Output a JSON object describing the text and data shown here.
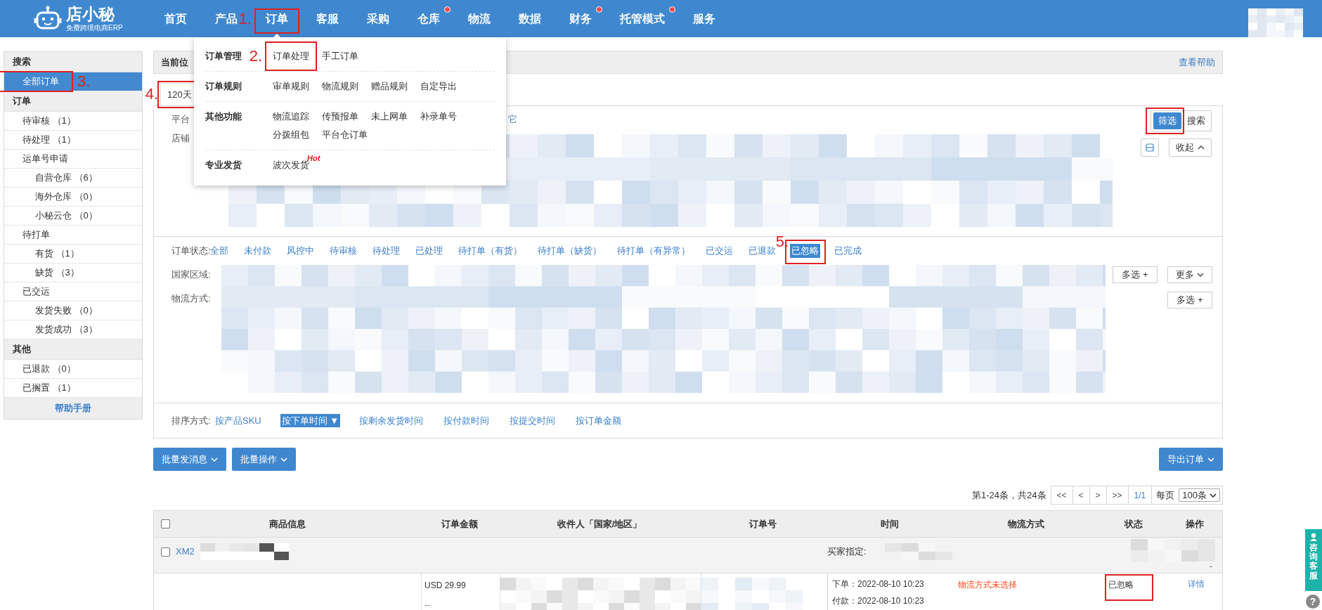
{
  "nav": {
    "logo_title": "店小秘",
    "logo_subtitle": "免费跨境电商ERP",
    "items": [
      {
        "label": "首页",
        "selected": false,
        "badge": false
      },
      {
        "label": "产品",
        "selected": false,
        "badge": false
      },
      {
        "label": "订单",
        "selected": true,
        "badge": false,
        "step": "1."
      },
      {
        "label": "客服",
        "selected": false,
        "badge": false
      },
      {
        "label": "采购",
        "selected": false,
        "badge": false
      },
      {
        "label": "仓库",
        "selected": false,
        "badge": true
      },
      {
        "label": "物流",
        "selected": false,
        "badge": false
      },
      {
        "label": "数据",
        "selected": false,
        "badge": false
      },
      {
        "label": "财务",
        "selected": false,
        "badge": true
      },
      {
        "label": "托管模式",
        "selected": false,
        "badge": true
      },
      {
        "label": "服务",
        "selected": false,
        "badge": false
      }
    ]
  },
  "dropdown": {
    "groups": [
      {
        "title": "订单管理",
        "items": [
          {
            "label": "订单处理",
            "step": "2."
          },
          {
            "label": "手工订单"
          }
        ]
      },
      {
        "title": "订单规则",
        "items": [
          {
            "label": "审单规则"
          },
          {
            "label": "物流规则"
          },
          {
            "label": "赠品规则"
          },
          {
            "label": "自定导出"
          }
        ]
      },
      {
        "title": "其他功能",
        "items": [
          {
            "label": "物流追踪"
          },
          {
            "label": "传预报单"
          },
          {
            "label": "未上网单"
          },
          {
            "label": "补录单号"
          },
          {
            "label": "分拨组包"
          },
          {
            "label": "平台仓订单"
          }
        ]
      },
      {
        "title": "专业发货",
        "items": [
          {
            "label": "波次发货",
            "tag": "Hot"
          }
        ]
      }
    ]
  },
  "sidebar": {
    "sections": [
      {
        "title": "搜索",
        "items": [
          {
            "label": "全部订单",
            "selected": true,
            "step": "3."
          }
        ]
      },
      {
        "title": "订单",
        "items": [
          {
            "label": "待审核 （1）",
            "selected": false
          },
          {
            "label": "待处理 （1）",
            "selected": false
          },
          {
            "label": "运单号申请",
            "selected": false,
            "children": [
              {
                "label": "自营仓库 （6）",
                "selected": false
              },
              {
                "label": "海外仓库 （0）",
                "selected": false
              },
              {
                "label": "小秘云仓 （0）",
                "selected": false
              }
            ]
          },
          {
            "label": "待打单",
            "selected": false,
            "children": [
              {
                "label": "有货 （1）",
                "selected": false
              },
              {
                "label": "缺货 （3）",
                "selected": false
              }
            ]
          },
          {
            "label": "已交运",
            "selected": false,
            "children": [
              {
                "label": "发货失败 （0）",
                "selected": false
              },
              {
                "label": "发货成功 （3）",
                "selected": false
              }
            ]
          }
        ]
      },
      {
        "title": "其他",
        "items": [
          {
            "label": "已退款 （0）",
            "selected": false
          },
          {
            "label": "已搁置 （1）",
            "selected": false
          }
        ]
      }
    ],
    "help": "帮助手册"
  },
  "breadcrumb": {
    "label": "当前位",
    "help": "查看帮助"
  },
  "period": {
    "label": "120天",
    "step": "4."
  },
  "filters": {
    "platform_label": "平台",
    "platform_tail": "它",
    "shop_label": "店铺",
    "filter_button": {
      "label": "筛选",
      "selected": true,
      "highlighted": true
    },
    "search_button": "搜索",
    "collapse_button": "收起"
  },
  "status": {
    "label": "订单状态:",
    "tabs": [
      {
        "label": "全部",
        "selected": false
      },
      {
        "label": "未付款",
        "selected": false
      },
      {
        "label": "风控中",
        "selected": false
      },
      {
        "label": "待审核",
        "selected": false
      },
      {
        "label": "待处理",
        "selected": false
      },
      {
        "label": "已处理",
        "selected": false
      },
      {
        "label": "待打单（有货）",
        "selected": false
      },
      {
        "label": "待打单（缺货）",
        "selected": false
      },
      {
        "label": "待打单（有异常）",
        "selected": false
      },
      {
        "label": "已交运",
        "selected": false
      },
      {
        "label": "已退款",
        "selected": false
      },
      {
        "label": "已忽略",
        "selected": true,
        "step": "5."
      },
      {
        "label": "已完成",
        "selected": false
      }
    ]
  },
  "region": {
    "label": "国家区域:",
    "multi": "多选 +",
    "more": "更多"
  },
  "logistics": {
    "label": "物流方式:",
    "multi": "多选 +"
  },
  "sort": {
    "label": "排序方式:",
    "options": [
      {
        "label": "按产品SKU",
        "selected": false
      },
      {
        "label": "按下单时间 ▼",
        "selected": true
      },
      {
        "label": "按剩余发货时间",
        "selected": false
      },
      {
        "label": "按付款时间",
        "selected": false
      },
      {
        "label": "按提交时间",
        "selected": false
      },
      {
        "label": "按订单金额",
        "selected": false
      }
    ]
  },
  "actions": {
    "left": [
      "批量发消息",
      "批量操作"
    ],
    "export": "导出订单"
  },
  "pagination": {
    "summary": "第1-24条，共24条",
    "buttons": [
      "<<",
      "<",
      ">",
      ">>"
    ],
    "page": "1/1",
    "per_page_label": "每页",
    "per_page": "100条"
  },
  "table": {
    "select_all": false,
    "columns": [
      "商品信息",
      "订单金额",
      "收件人「国家/地区」",
      "订单号",
      "时间",
      "物流方式",
      "状态",
      "操作"
    ],
    "groups": [
      {
        "checked": false,
        "order_prefix": "XM2",
        "buyer_label": "买家指定:",
        "tail": "-",
        "rows": [
          {
            "amount": "USD 29.99",
            "amount_note": "--",
            "times": [
              "下单：2022-08-10 10:23",
              "付款：2022-08-10 10:23"
            ],
            "logistics": "物流方式未选择",
            "status": {
              "label": "已忽略",
              "highlighted": true
            },
            "action": "详情"
          }
        ]
      }
    ]
  },
  "support_widget": {
    "label": "咨询客服",
    "help_glyph": "?"
  }
}
